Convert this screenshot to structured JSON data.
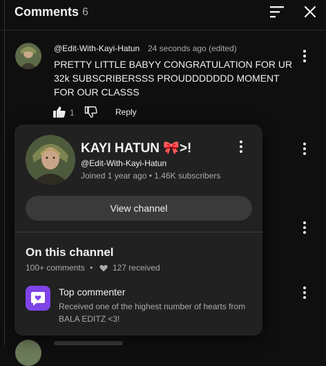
{
  "header": {
    "title": "Comments",
    "count": "6",
    "sort_icon": "sort-icon",
    "close_icon": "close-icon"
  },
  "comment": {
    "author": "@Edit-With-Kayi-Hatun",
    "meta": "24 seconds ago (edited)",
    "text": "PRETTY LITTLE BABYY CONGRATULATION FOR UR 32k SUBSCRIBERSSS PROUDDDDDDD MOMENT FOR OUR CLASSS",
    "likes": "1",
    "reply_label": "Reply"
  },
  "channel_card": {
    "name": "KAYI HATUN 🎀>!",
    "handle": "@Edit-With-Kayi-Hatun",
    "meta": "Joined 1 year ago • 1.46K subscribers",
    "view_button": "View channel",
    "section_title": "On this channel",
    "stats": {
      "comments": "100+ comments",
      "separator": "•",
      "received": "127 received"
    },
    "badge": {
      "title": "Top commenter",
      "description": "Received one of the highest number of hearts from BALA EDITZ <3!"
    }
  },
  "colors": {
    "background": "#0f0f0f",
    "card": "#212121",
    "button": "#3a3a3a",
    "badge": "#7e44e8",
    "secondary_text": "#aaaaaa"
  }
}
